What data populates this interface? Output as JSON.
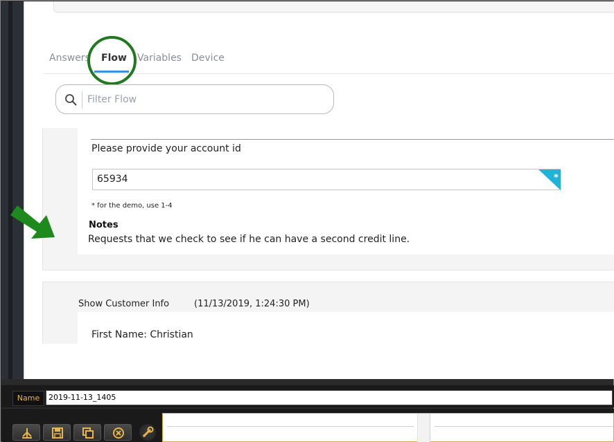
{
  "tabs": [
    {
      "label": "Answers"
    },
    {
      "label": "Flow"
    },
    {
      "label": "Variables"
    },
    {
      "label": "Device"
    }
  ],
  "active_tab": "Flow",
  "search": {
    "placeholder": "Filter Flow",
    "value": ""
  },
  "steps": [
    {
      "prompt": "Please provide your account id",
      "answer": "65934",
      "required_mark": "*",
      "hint": "* for the demo, use 1-4",
      "notes_label": "Notes",
      "notes": "Requests that we check to see if he can have a second credit line."
    },
    {
      "title": "Show Customer Info",
      "timestamp": "(11/13/2019, 1:24:30 PM)",
      "first_name_line": "First Name: Christian"
    }
  ],
  "name_bar": {
    "label": "Name",
    "value": "2019-11-13_1405"
  },
  "toolbar": {
    "buttons": [
      {
        "icon": "flow-tree-icon"
      },
      {
        "icon": "save-icon"
      },
      {
        "icon": "copy-icon"
      },
      {
        "icon": "cancel-circle-icon"
      },
      {
        "icon": "wrench-icon"
      }
    ]
  },
  "colors": {
    "tab_active_underline": "#3c8fde",
    "highlight_circle": "#1f7a1f",
    "annotation_arrow": "#1e8a1e",
    "required_corner": "#20b3d8",
    "name_label_text": "#e8b548"
  }
}
